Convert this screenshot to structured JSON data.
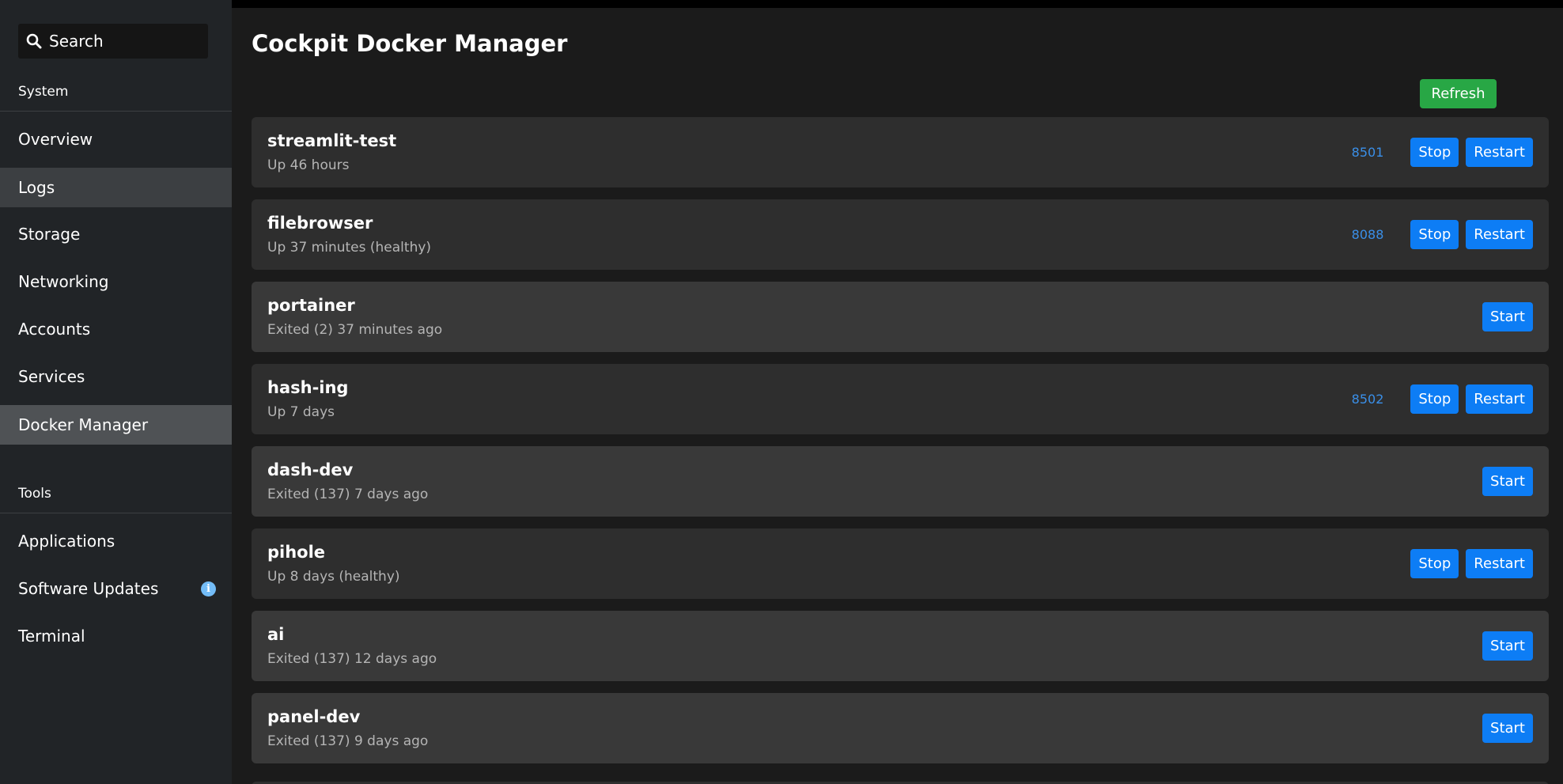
{
  "sidebar": {
    "search_label": "Search",
    "section_system": "System",
    "system_items": [
      {
        "label": "Overview"
      },
      {
        "label": "Logs"
      },
      {
        "label": "Storage"
      },
      {
        "label": "Networking"
      },
      {
        "label": "Accounts"
      },
      {
        "label": "Services"
      },
      {
        "label": "Docker Manager"
      }
    ],
    "section_tools": "Tools",
    "tools_items": [
      {
        "label": "Applications"
      },
      {
        "label": "Software Updates",
        "badge": "i"
      },
      {
        "label": "Terminal"
      }
    ]
  },
  "page": {
    "title": "Cockpit Docker Manager",
    "refresh_label": "Refresh"
  },
  "containers": [
    {
      "name": "streamlit-test",
      "status": "Up 46 hours",
      "port": "8501",
      "buttons": [
        "Stop",
        "Restart"
      ]
    },
    {
      "name": "filebrowser",
      "status": "Up 37 minutes (healthy)",
      "port": "8088",
      "buttons": [
        "Stop",
        "Restart"
      ]
    },
    {
      "name": "portainer",
      "status": "Exited (2) 37 minutes ago",
      "port": "",
      "buttons": [
        "Start"
      ]
    },
    {
      "name": "hash-ing",
      "status": "Up 7 days",
      "port": "8502",
      "buttons": [
        "Stop",
        "Restart"
      ]
    },
    {
      "name": "dash-dev",
      "status": "Exited (137) 7 days ago",
      "port": "",
      "buttons": [
        "Start"
      ]
    },
    {
      "name": "pihole",
      "status": "Up 8 days (healthy)",
      "port": "",
      "buttons": [
        "Stop",
        "Restart"
      ]
    },
    {
      "name": "ai",
      "status": "Exited (137) 12 days ago",
      "port": "",
      "buttons": [
        "Start"
      ]
    },
    {
      "name": "panel-dev",
      "status": "Exited (137) 9 days ago",
      "port": "",
      "buttons": [
        "Start"
      ]
    }
  ],
  "colors": {
    "accent_blue": "#0d7df5",
    "refresh_green": "#28a745",
    "link_blue": "#3a8fe8"
  }
}
